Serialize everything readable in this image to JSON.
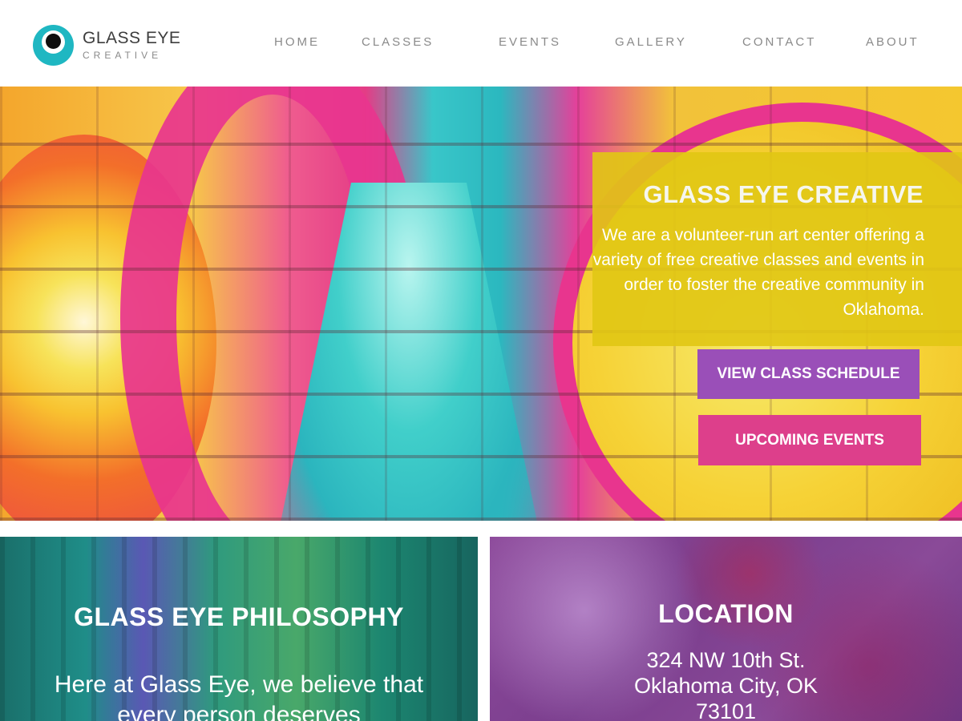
{
  "logo": {
    "name": "GLASS EYE",
    "subtitle": "CREATIVE",
    "icon": "eye-logo-icon"
  },
  "nav": {
    "items": [
      "HOME",
      "CLASSES",
      "EVENTS",
      "GALLERY",
      "CONTACT",
      "ABOUT"
    ]
  },
  "hero": {
    "title": "GLASS EYE CREATIVE",
    "description": "We are a volunteer-run art center offering a variety of free creative classes and events in order to foster the creative community in Oklahoma.",
    "buttons": {
      "schedule": "VIEW CLASS SCHEDULE",
      "events": "UPCOMING EVENTS"
    }
  },
  "philosophy": {
    "title": "GLASS EYE PHILOSOPHY",
    "text": "Here at Glass Eye, we believe that every person deserves"
  },
  "location": {
    "title": "LOCATION",
    "address": "324 NW 10th St.\nOklahoma City, OK\n73101"
  },
  "colors": {
    "accent_yellow": "#e1c614",
    "button_purple": "#9a4fb8",
    "button_pink": "#dd3f8b",
    "logo_teal": "#1fb7c2"
  }
}
